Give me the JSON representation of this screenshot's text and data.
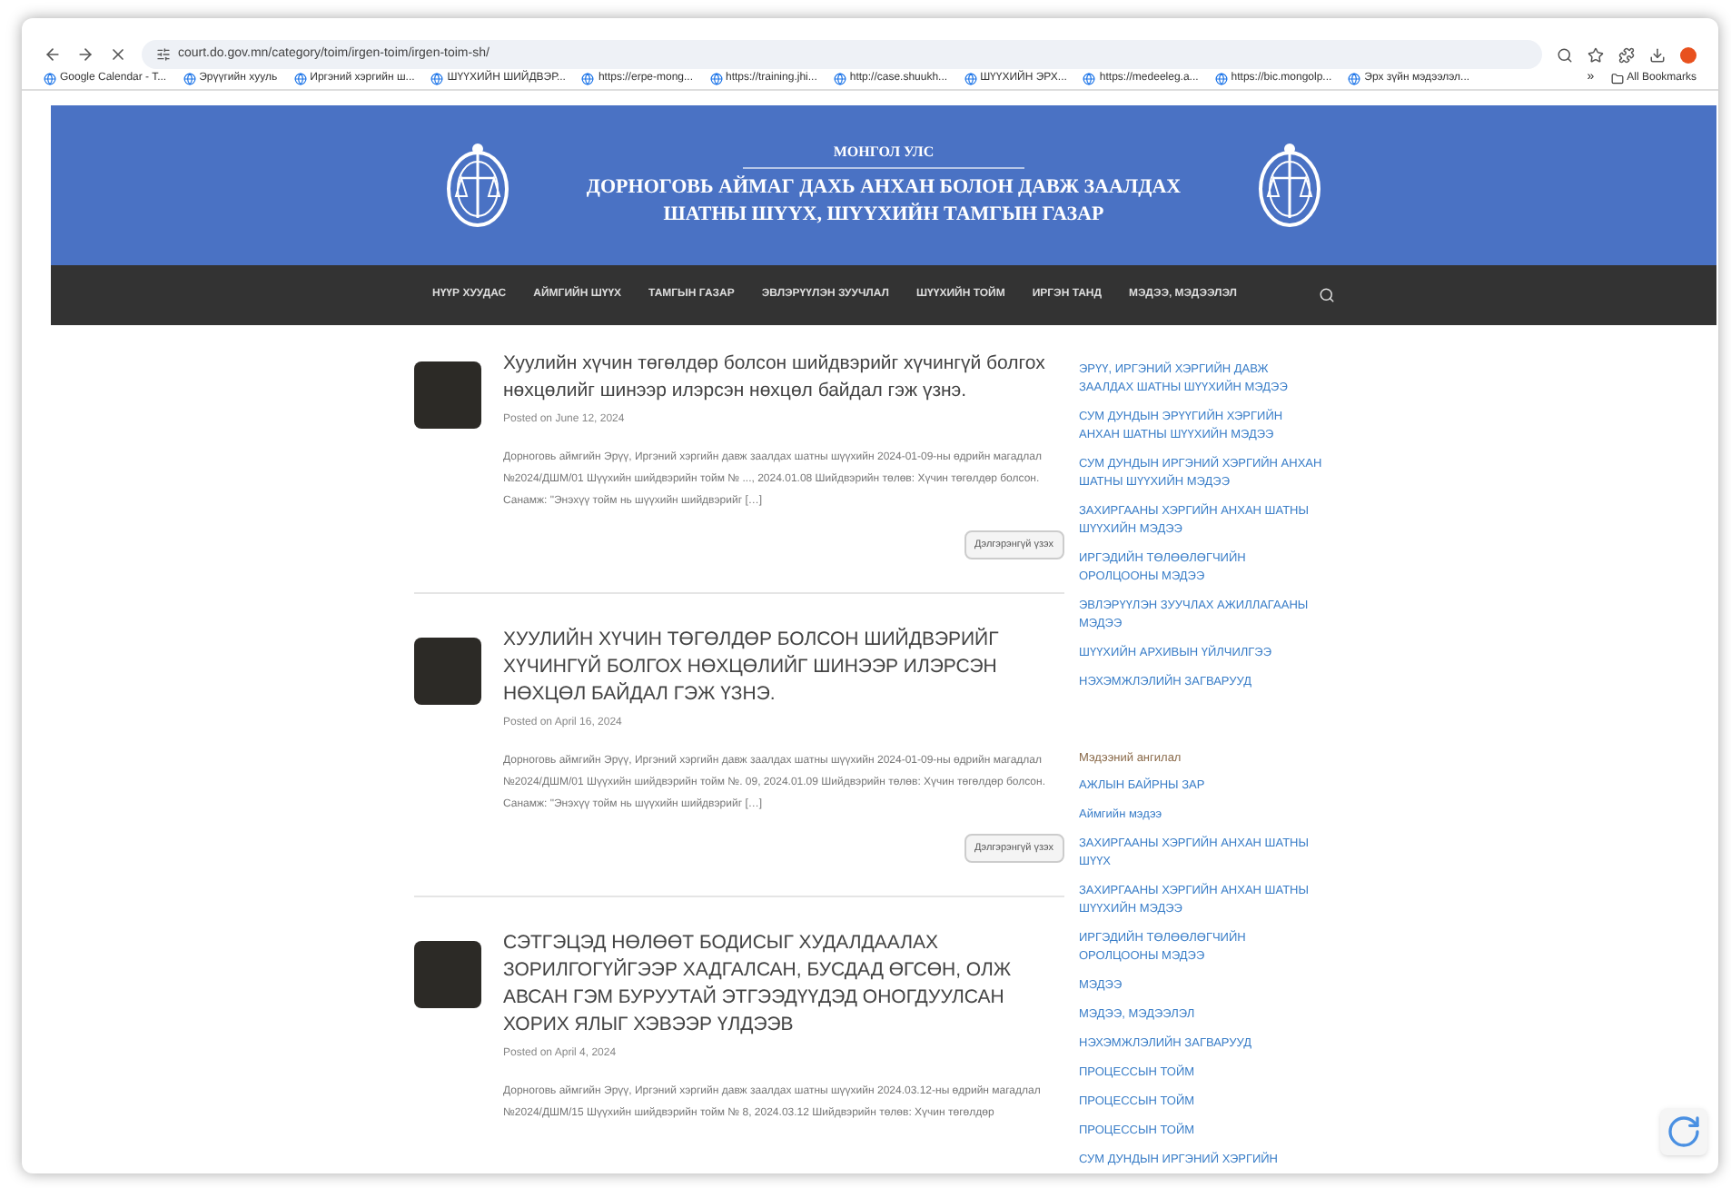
{
  "browser": {
    "url": "court.do.gov.mn/category/toim/irgen-toim/irgen-toim-sh/",
    "bookmarks": [
      "Google Calendar - T...",
      "Эрүүгийн хууль",
      "Иргэний хэргийн ш...",
      "ШҮҮХИЙН ШИЙДВЭР...",
      "https://erpe-mong...",
      "https://training.jhi...",
      "http://case.shuukh...",
      "ШҮҮХИЙН ЭРХ...",
      "https://medeeleg.a...",
      "https://bic.mongolp...",
      "Эрх зүйн мэдээлэл..."
    ],
    "overflow": "»",
    "all_bookmarks": "All Bookmarks"
  },
  "header": {
    "country": "МОНГОЛ УЛС",
    "title_lines": [
      "ДОРНОГОВЬ АЙМАГ ДАХЬ АНХАН БОЛОН ДАВЖ ЗААЛДАХ",
      "ШАТНЫ ШҮҮХ, ШҮҮХИЙН ТАМГЫН ГАЗАР"
    ]
  },
  "nav": {
    "items": [
      "НҮҮР ХУУДАС",
      "АЙМГИЙН ШҮҮХ",
      "ТАМГЫН ГАЗАР",
      "ЭВЛЭРҮҮЛЭН ЗУУЧЛАЛ",
      "ШҮҮХИЙН ТОЙМ",
      "ИРГЭН ТАНД",
      "МЭДЭЭ, МЭДЭЭЛЭЛ"
    ]
  },
  "posts": [
    {
      "title": "Хуулийн хүчин төгөлдөр болсон шийдвэрийг хүчингүй болгох нөхцөлийг шинээр илэрсэн нөхцөл байдал гэж үзнэ.",
      "date": "Posted on June 12, 2024",
      "excerpt": "Дорноговь аймгийн Эрүү, Иргэний хэргийн давж заалдах шатны шүүхийн 2024-01-09-ны өдрийн магадлал №2024/ДШМ/01 Шүүхийн шийдвэрийн тойм № ..., 2024.01.08 Шийдвэрийн төлөв: Хүчин төгөлдөр болсон. Санамж: \"Энэхүү тойм нь шүүхийн шийдвэрийг […]",
      "button": "Дэлгэрэнгүй үзэх"
    },
    {
      "title": "ХУУЛИЙН ХҮЧИН ТӨГӨЛДӨР БОЛСОН ШИЙДВЭРИЙГ ХҮЧИНГҮЙ БОЛГОХ НӨХЦӨЛИЙГ ШИНЭЭР ИЛЭРСЭН НӨХЦӨЛ БАЙДАЛ ГЭЖ ҮЗНЭ.",
      "date": "Posted on April 16, 2024",
      "excerpt": "Дорноговь аймгийн Эрүү, Иргэний хэргийн давж заалдах шатны шүүхийн 2024-01-09-ны өдрийн магадлал №2024/ДШМ/01 Шүүхийн шийдвэрийн тойм №. 09, 2024.01.09 Шийдвэрийн төлөв: Хүчин төгөлдөр болсон. Санамж: \"Энэхүү тойм нь шүүхийн шийдвэрийг […]",
      "button": "Дэлгэрэнгүй үзэх"
    },
    {
      "title": "СЭТГЭЦЭД НӨЛӨӨТ БОДИСЫГ ХУДАЛДААЛАХ ЗОРИЛГОГҮЙГЭЭР ХАДГАЛСАН, БУСДАД ӨГСӨН, ОЛЖ АВСАН ГЭМ БУРУУТАЙ ЭТГЭЭДҮҮДЭД ОНОГДУУЛСАН ХОРИХ ЯЛЫГ ХЭВЭЭР ҮЛДЭЭВ",
      "date": "Posted on April 4, 2024",
      "excerpt": "Дорноговь аймгийн Эрүү, Иргэний хэргийн давж заалдах шатны шүүхийн 2024.03.12-ны өдрийн магадлал №2024/ДШМ/15 Шүүхийн шийдвэрийн тойм № 8, 2024.03.12 Шийдвэрийн төлөв: Хүчин төгөлдөр"
    }
  ],
  "sidebar": {
    "links": [
      "ЭРҮҮ, ИРГЭНИЙ ХЭРГИЙН ДАВЖ ЗААЛДАХ ШАТНЫ ШҮҮХИЙН МЭДЭЭ",
      "СУМ ДУНДЫН ЭРҮҮГИЙН ХЭРГИЙН АНХАН ШАТНЫ ШҮҮХИЙН МЭДЭЭ",
      "СУМ ДУНДЫН ИРГЭНИЙ ХЭРГИЙН АНХАН ШАТНЫ ШҮҮХИЙН МЭДЭЭ",
      "ЗАХИРГААНЫ ХЭРГИЙН АНХАН ШАТНЫ ШҮҮХИЙН МЭДЭЭ",
      "ИРГЭДИЙН ТӨЛӨӨЛӨГЧИЙН ОРОЛЦООНЫ МЭДЭЭ",
      "ЭВЛЭРҮҮЛЭН ЗУУЧЛАХ АЖИЛЛАГААНЫ МЭДЭЭ",
      "ШҮҮХИЙН АРХИВЫН ҮЙЛЧИЛГЭЭ",
      "НЭХЭМЖЛЭЛИЙН ЗАГВАРУУД"
    ],
    "category_heading": "Мэдээний ангилал",
    "categories": [
      "АЖЛЫН БАЙРНЫ ЗАР",
      "Аймгийн мэдээ",
      "ЗАХИРГААНЫ ХЭРГИЙН АНХАН ШАТНЫ ШҮҮХ",
      "ЗАХИРГААНЫ ХЭРГИЙН АНХАН ШАТНЫ ШҮҮХИЙН МЭДЭЭ",
      "ИРГЭДИЙН ТӨЛӨӨЛӨГЧИЙН ОРОЛЦООНЫ МЭДЭЭ",
      "МЭДЭЭ",
      "МЭДЭЭ, МЭДЭЭЛЭЛ",
      "НЭХЭМЖЛЭЛИЙН ЗАГВАРУУД",
      "ПРОЦЕССЫН ТОЙМ",
      "ПРОЦЕССЫН ТОЙМ",
      "ПРОЦЕССЫН ТОЙМ",
      "СУМ ДУНДЫН ИРГЭНИЙ ХЭРГИЙН"
    ]
  }
}
